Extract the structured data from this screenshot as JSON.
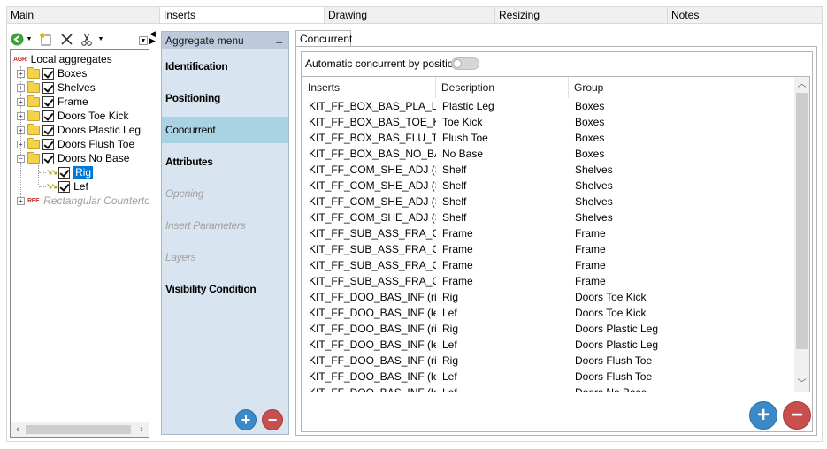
{
  "top_tabs": [
    {
      "label": "Main"
    },
    {
      "label": "Inserts"
    },
    {
      "label": "Drawing"
    },
    {
      "label": "Resizing"
    },
    {
      "label": "Notes"
    }
  ],
  "toolbar": {
    "back_icon": "back-arrow-icon",
    "new_icon": "new-item-icon",
    "delete_icon": "delete-x-icon",
    "cut_icon": "scissors-icon"
  },
  "tree": {
    "root_tag": "AGR",
    "root_label": "Local aggregates",
    "items": [
      {
        "label": "Boxes"
      },
      {
        "label": "Shelves"
      },
      {
        "label": "Frame"
      },
      {
        "label": "Doors Toe Kick"
      },
      {
        "label": "Doors Plastic Leg"
      },
      {
        "label": "Doors Flush Toe"
      },
      {
        "label": "Doors No Base"
      }
    ],
    "children": [
      {
        "label": "Rig"
      },
      {
        "label": "Lef"
      }
    ],
    "ref_tag": "REF",
    "ref_label": "Rectangular Countertop"
  },
  "aggregate_menu": {
    "title": "Aggregate menu",
    "items": [
      {
        "label": "Identification",
        "state": "normal"
      },
      {
        "label": "Positioning",
        "state": "normal"
      },
      {
        "label": "Concurrent",
        "state": "active"
      },
      {
        "label": "Attributes",
        "state": "normal"
      },
      {
        "label": "Opening",
        "state": "disabled"
      },
      {
        "label": "Insert Parameters",
        "state": "disabled"
      },
      {
        "label": "Layers",
        "state": "disabled"
      },
      {
        "label": "Visibility Condition",
        "state": "normal"
      }
    ],
    "add_symbol": "+",
    "remove_symbol": "−"
  },
  "concurrent": {
    "tab_label": "Concurrent",
    "auto_label": "Automatic concurrent by position",
    "auto_enabled": false,
    "columns": [
      "Inserts",
      "Description",
      "Group"
    ],
    "rows": [
      [
        "KIT_FF_BOX_BAS_PLA_LE...",
        "Plastic Leg",
        "Boxes"
      ],
      [
        "KIT_FF_BOX_BAS_TOE_KI...",
        "Toe Kick",
        "Boxes"
      ],
      [
        "KIT_FF_BOX_BAS_FLU_T...",
        "Flush Toe",
        "Boxes"
      ],
      [
        "KIT_FF_BOX_BAS_NO_BA...",
        "No Base",
        "Boxes"
      ],
      [
        "KIT_FF_COM_SHE_ADJ (S...",
        "Shelf",
        "Shelves"
      ],
      [
        "KIT_FF_COM_SHE_ADJ (S...",
        "Shelf",
        "Shelves"
      ],
      [
        "KIT_FF_COM_SHE_ADJ (S...",
        "Shelf",
        "Shelves"
      ],
      [
        "KIT_FF_COM_SHE_ADJ (S...",
        "Shelf",
        "Shelves"
      ],
      [
        "KIT_FF_SUB_ASS_FRA_C...",
        "Frame",
        "Frame"
      ],
      [
        "KIT_FF_SUB_ASS_FRA_C...",
        "Frame",
        "Frame"
      ],
      [
        "KIT_FF_SUB_ASS_FRA_C...",
        "Frame",
        "Frame"
      ],
      [
        "KIT_FF_SUB_ASS_FRA_C...",
        "Frame",
        "Frame"
      ],
      [
        "KIT_FF_DOO_BAS_INF (rig...",
        "Rig",
        "Doors Toe Kick"
      ],
      [
        "KIT_FF_DOO_BAS_INF (lef...",
        "Lef",
        "Doors Toe Kick"
      ],
      [
        "KIT_FF_DOO_BAS_INF (rig...",
        "Rig",
        "Doors Plastic Leg"
      ],
      [
        "KIT_FF_DOO_BAS_INF (lef...",
        "Lef",
        "Doors Plastic Leg"
      ],
      [
        "KIT_FF_DOO_BAS_INF (rig...",
        "Rig",
        "Doors Flush Toe"
      ],
      [
        "KIT_FF_DOO_BAS_INF (lef...",
        "Lef",
        "Doors Flush Toe"
      ],
      [
        "KIT_FF_DOO_BAS_INF (lef...",
        "Lef",
        "Doors No Base"
      ]
    ],
    "add_symbol": "+",
    "remove_symbol": "−"
  },
  "colors": {
    "accent_blue": "#3c89c9",
    "remove_red": "#c94f4f",
    "selection": "#0078d7",
    "menu_bg": "#d9e4f1",
    "menu_active": "#a9d3e3"
  }
}
